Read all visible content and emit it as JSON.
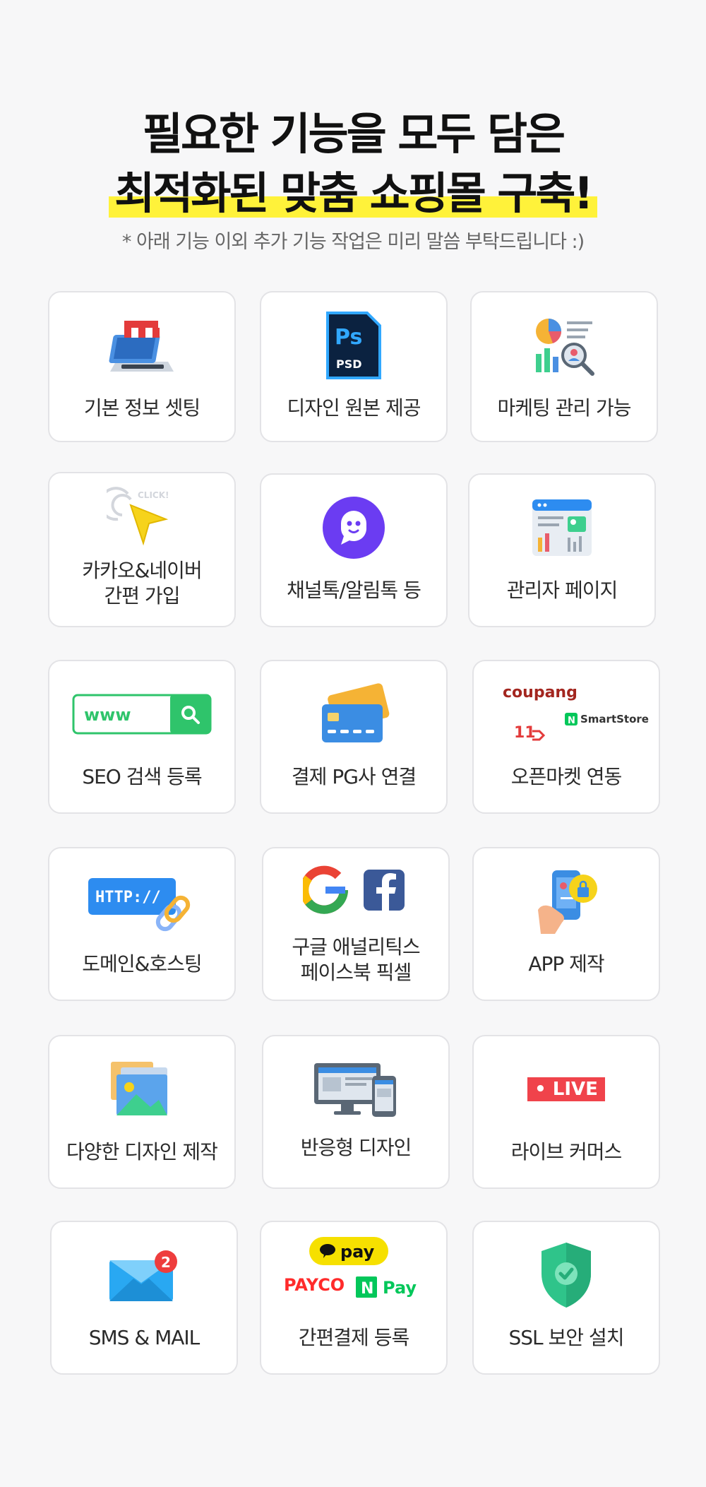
{
  "header": {
    "title_line1": "필요한 기능을 모두 담은",
    "title_line2": "최적화된 맞춤 쇼핑몰 구축!",
    "subtitle": "* 아래 기능 이외 추가 기능 작업은 미리 말씀 부탁드립니다 :)",
    "highlight_color": "#fff23a"
  },
  "features": [
    {
      "label": "기본 정보 셋팅",
      "icon": "laptop-shop-icon"
    },
    {
      "label": "디자인 원본 제공",
      "icon": "photoshop-psd-icon",
      "icon_text": "Ps",
      "icon_subtext": "PSD"
    },
    {
      "label": "마케팅 관리 가능",
      "icon": "marketing-analytics-icon"
    },
    {
      "label_lines": [
        "카카오&네이버",
        "간편 가입"
      ],
      "icon": "click-cursor-icon",
      "icon_text": "CLICK!"
    },
    {
      "label": "채널톡/알림톡 등",
      "icon": "chat-bubble-icon"
    },
    {
      "label": "관리자 페이지",
      "icon": "admin-dashboard-icon"
    },
    {
      "label": "SEO 검색 등록",
      "icon": "search-bar-icon",
      "icon_text": "www"
    },
    {
      "label": "결제 PG사 연결",
      "icon": "credit-card-icon"
    },
    {
      "label": "오픈마켓 연동",
      "icon": "open-market-logos-icon",
      "icon_text": "coupang",
      "icon_subtext": "SmartStore",
      "icon_extra": "11"
    },
    {
      "label": "도메인&호스팅",
      "icon": "http-link-icon",
      "icon_text": "HTTP://"
    },
    {
      "label_lines": [
        "구글 애널리틱스",
        "페이스북 픽셀"
      ],
      "icon": "google-facebook-icon"
    },
    {
      "label": "APP 제작",
      "icon": "mobile-app-icon"
    },
    {
      "label": "다양한 디자인 제작",
      "icon": "image-gallery-icon"
    },
    {
      "label": "반응형 디자인",
      "icon": "responsive-devices-icon"
    },
    {
      "label": "라이브 커머스",
      "icon": "live-badge-icon",
      "icon_text": "• LIVE"
    },
    {
      "label": "SMS & MAIL",
      "icon": "mail-notification-icon",
      "icon_text": "2"
    },
    {
      "label": "간편결제 등록",
      "icon": "payment-logos-icon",
      "icon_text": "pay",
      "icon_subtext": "PAYCO",
      "icon_extra": "Pay"
    },
    {
      "label": "SSL 보안 설치",
      "icon": "security-shield-icon"
    }
  ]
}
